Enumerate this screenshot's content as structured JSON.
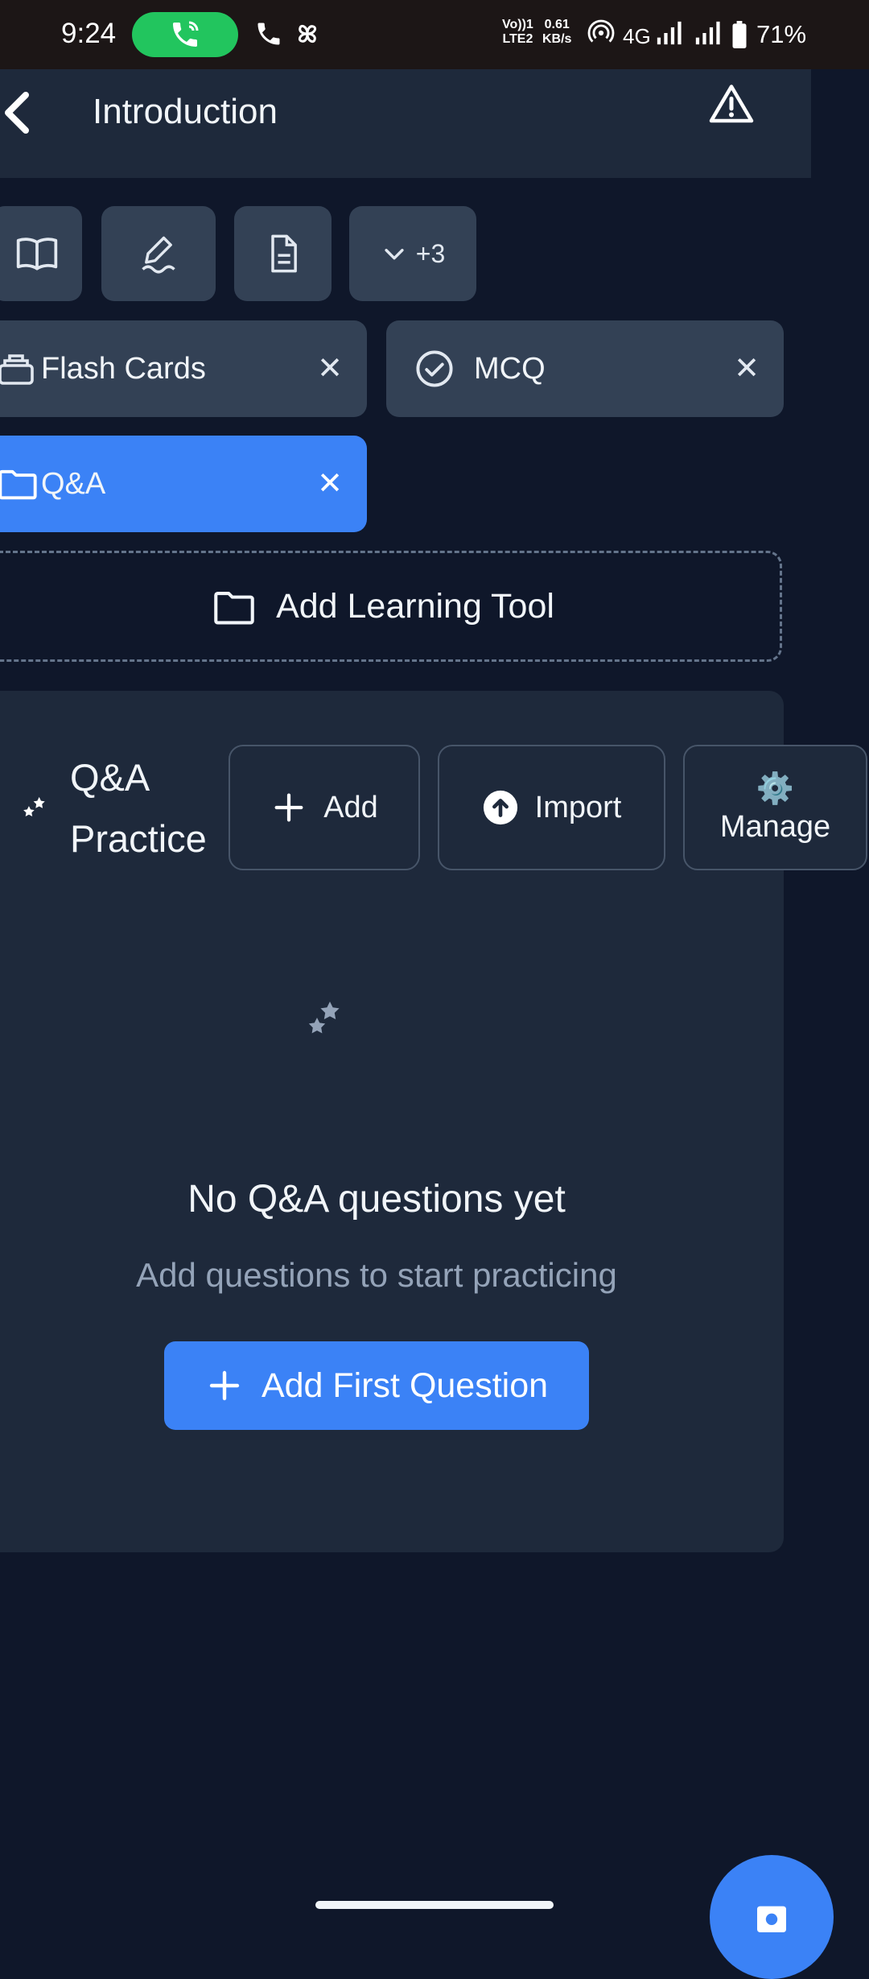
{
  "status_bar": {
    "time": "9:24",
    "volte_line1": "Vo))1",
    "volte_line2": "LTE2",
    "speed_line1": "0.61",
    "speed_line2": "KB/s",
    "network": "4G",
    "battery": "71%"
  },
  "header": {
    "title": "Introduction"
  },
  "toolbar": {
    "more_label": "+3"
  },
  "chips": [
    {
      "label": "Flash Cards",
      "close": "✕"
    },
    {
      "label": "MCQ",
      "close": "✕"
    },
    {
      "label": "Q&A",
      "close": "✕",
      "active": true
    }
  ],
  "add_tool": {
    "label": "Add Learning Tool"
  },
  "qa_panel": {
    "title_line1": "Q&A",
    "title_line2": "Practice",
    "add_label": "Add",
    "import_label": "Import",
    "manage_label": "Manage",
    "manage_icon": "⚙️",
    "empty_title": "No Q&A questions yet",
    "empty_subtitle": "Add questions to start practicing",
    "add_first_label": "Add First Question"
  },
  "colors": {
    "background": "#0f172a",
    "surface": "#1e293b",
    "chip": "#334155",
    "accent": "#3b82f6"
  }
}
